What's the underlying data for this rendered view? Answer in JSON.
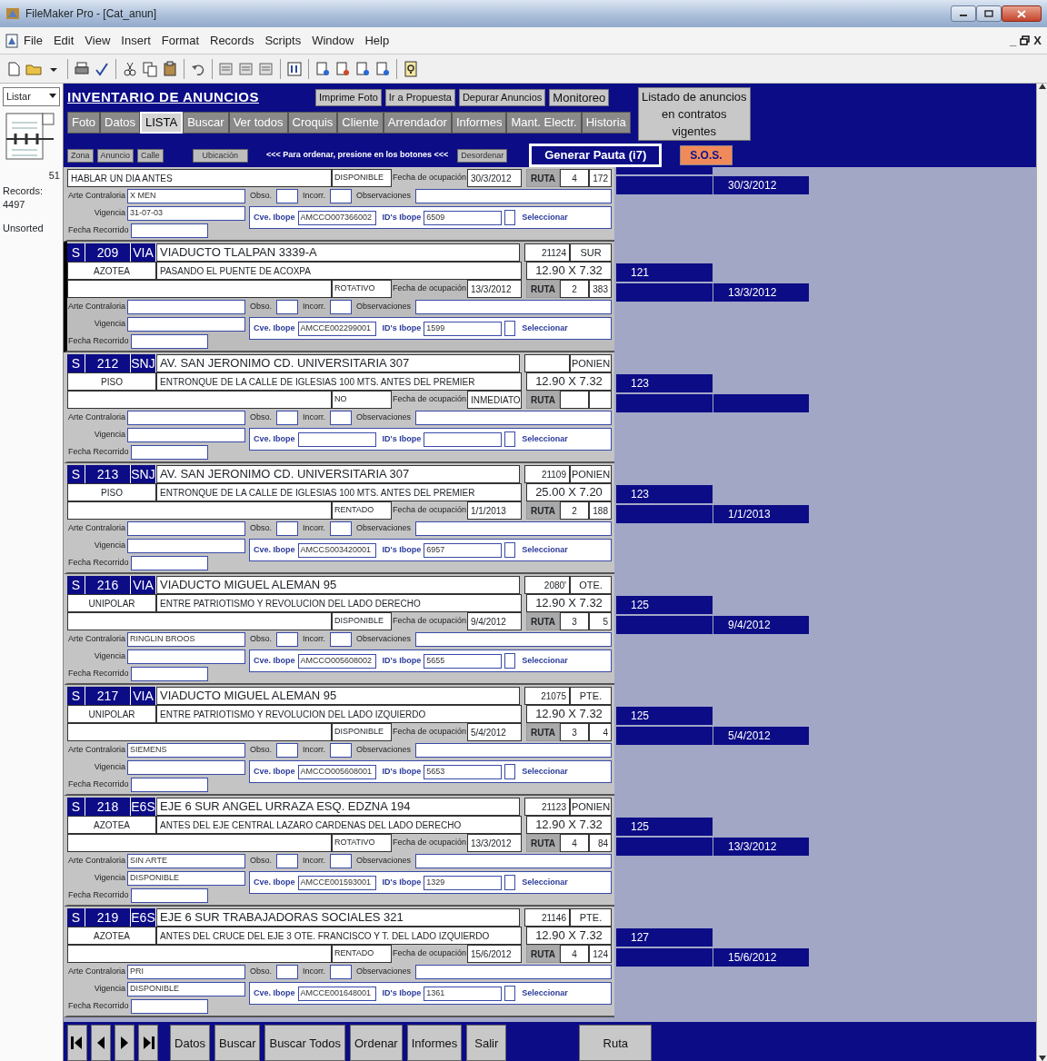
{
  "window": {
    "title": "FileMaker Pro - [Cat_anun]"
  },
  "menu": [
    "File",
    "Edit",
    "View",
    "Insert",
    "Format",
    "Records",
    "Scripts",
    "Window",
    "Help"
  ],
  "doc_controls": [
    "_",
    "X"
  ],
  "status_panel": {
    "layout": "Listar",
    "record_number": "51",
    "records_label": "Records:",
    "records_count": "4497",
    "sort_state": "Unsorted"
  },
  "header": {
    "title": "INVENTARIO DE ANUNCIOS",
    "buttons": [
      "Imprime Foto",
      "Ir a Propuesta",
      "Depurar Anuncios",
      "Monitoreo"
    ],
    "listado_button": "Listado de anuncios en contratos vigentes",
    "tabs": [
      {
        "label": "Foto",
        "selected": false
      },
      {
        "label": "Datos",
        "selected": false
      },
      {
        "label": "LISTA",
        "selected": true
      },
      {
        "label": "Buscar",
        "selected": false
      },
      {
        "label": "Ver todos",
        "selected": false
      },
      {
        "label": "Croquis",
        "selected": false
      },
      {
        "label": "Cliente",
        "selected": false
      },
      {
        "label": "Arrendador",
        "selected": false
      },
      {
        "label": "Informes",
        "selected": false
      },
      {
        "label": "Mant. Electr.",
        "selected": false
      },
      {
        "label": "Historia",
        "selected": false
      }
    ],
    "sort_buttons": [
      "Zona",
      "Anuncio",
      "Calle"
    ],
    "location_button": "Ubicación",
    "sort_hint": "<<< Para ordenar, presione en los botones <<<",
    "unsort_button": "Desordenar",
    "generar_button": "Generar Pauta (i7)",
    "sos_button": "S.O.S."
  },
  "records": [
    {
      "selected": false,
      "note": "HABLAR UN DIA ANTES",
      "status": "DISPONIBLE",
      "fecha_label": "Fecha de ocupación",
      "fecha": "30/3/2012",
      "ruta_label": "RUTA",
      "ruta": "4",
      "ruta_seq": "172",
      "arte_label": "Arte Contraloria",
      "arte": "X MEN",
      "obso_label": "Obso.",
      "incorr_label": "Incorr.",
      "obs_label": "Observaciones",
      "vigencia_label": "Vigencia",
      "vigencia": "31-07-03",
      "recorrido_label": "Fecha Recorrido",
      "cve_label": "Cve. Ibope",
      "cve": "AMCCO007366002",
      "ids_label": "ID's Ibope",
      "ids": "6509",
      "checked": false,
      "select_label": "Seleccionar",
      "side_date": "30/3/2012"
    },
    {
      "selected": true,
      "side": "S",
      "number": "209",
      "code": "VIA",
      "address": "VIADUCTO TLALPAN  3339-A",
      "ref_number": "21124",
      "direction": "SUR",
      "type": "AZOTEA",
      "reference": "PASANDO EL PUENTE DE ACOXPA",
      "size": "12.90  X  7.32",
      "status": "ROTATIVO",
      "fecha_label": "Fecha de ocupación",
      "fecha": "13/3/2012",
      "ruta_label": "RUTA",
      "ruta": "2",
      "ruta_seq": "383",
      "arte_label": "Arte Contraloria",
      "obso_label": "Obso.",
      "incorr_label": "Incorr.",
      "obs_label": "Observaciones",
      "vigencia_label": "Vigencia",
      "recorrido_label": "Fecha Recorrido",
      "cve_label": "Cve. Ibope",
      "cve": "AMCCE002299001",
      "ids_label": "ID's Ibope",
      "ids": "1599",
      "checked": false,
      "select_label": "Seleccionar",
      "side_number": "121",
      "side_date": "13/3/2012"
    },
    {
      "selected": false,
      "side": "S",
      "number": "212",
      "code": "SNJ",
      "address": "AV. SAN JERONIMO  CD. UNIVERSITARIA 307",
      "direction": "PONIEN",
      "type": "PISO",
      "reference": "ENTRONQUE DE LA CALLE DE IGLESIAS 100 MTS. ANTES DEL PREMIER",
      "size": "12.90  X  7.32",
      "status": "NO",
      "fecha_label": "Fecha de ocupación",
      "fecha": "INMEDIATO",
      "ruta_label": "RUTA",
      "arte_label": "Arte Contraloria",
      "obso_label": "Obso.",
      "incorr_label": "Incorr.",
      "obs_label": "Observaciones",
      "vigencia_label": "Vigencia",
      "recorrido_label": "Fecha Recorrido",
      "cve_label": "Cve. Ibope",
      "ids_label": "ID's Ibope",
      "checked": false,
      "select_label": "Seleccionar",
      "side_number": "123"
    },
    {
      "selected": false,
      "side": "S",
      "number": "213",
      "code": "SNJ",
      "address": "AV. SAN JERONIMO  CD. UNIVERSITARIA 307",
      "ref_number": "21109",
      "direction": "PONIEN",
      "type": "PISO",
      "reference": "ENTRONQUE DE LA CALLE DE IGLESIAS 100 MTS. ANTES DEL PREMIER",
      "size": "25.00  X  7.20",
      "status": "RENTADO",
      "fecha_label": "Fecha de ocupación",
      "fecha": "1/1/2013",
      "ruta_label": "RUTA",
      "ruta": "2",
      "ruta_seq": "188",
      "arte_label": "Arte Contraloria",
      "obso_label": "Obso.",
      "incorr_label": "Incorr.",
      "obs_label": "Observaciones",
      "vigencia_label": "Vigencia",
      "recorrido_label": "Fecha Recorrido",
      "cve_label": "Cve. Ibope",
      "cve": "AMCCS003420001",
      "ids_label": "ID's Ibope",
      "ids": "6957",
      "checked": false,
      "select_label": "Seleccionar",
      "side_number": "123",
      "side_date": "1/1/2013"
    },
    {
      "selected": false,
      "side": "S",
      "number": "216",
      "code": "VIA",
      "address": "VIADUCTO MIGUEL ALEMAN 95",
      "ref_number": "2080'",
      "direction": "OTE.",
      "type": "UNIPOLAR",
      "reference": "ENTRE PATRIOTISMO Y REVOLUCION DEL LADO DERECHO",
      "size": "12.90  X  7.32",
      "status": "DISPONIBLE",
      "fecha_label": "Fecha de ocupación",
      "fecha": "9/4/2012",
      "ruta_label": "RUTA",
      "ruta": "3",
      "ruta_seq": "5",
      "arte_label": "Arte Contraloria",
      "arte": "RINGLIN BROOS",
      "obso_label": "Obso.",
      "incorr_label": "Incorr.",
      "obs_label": "Observaciones",
      "vigencia_label": "Vigencia",
      "recorrido_label": "Fecha Recorrido",
      "cve_label": "Cve. Ibope",
      "cve": "AMCCO005608002",
      "ids_label": "ID's Ibope",
      "ids": "5655",
      "checked": false,
      "select_label": "Seleccionar",
      "side_number": "125",
      "side_date": "9/4/2012"
    },
    {
      "selected": false,
      "side": "S",
      "number": "217",
      "code": "VIA",
      "address": "VIADUCTO MIGUEL ALEMAN 95",
      "ref_number": "21075",
      "direction": "PTE.",
      "type": "UNIPOLAR",
      "reference": "ENTRE PATRIOTISMO Y REVOLUCION DEL LADO IZQUIERDO",
      "size": "12.90  X  7.32",
      "status": "DISPONIBLE",
      "fecha_label": "Fecha de ocupación",
      "fecha": "5/4/2012",
      "ruta_label": "RUTA",
      "ruta": "3",
      "ruta_seq": "4",
      "arte_label": "Arte Contraloria",
      "arte": "SIEMENS",
      "obso_label": "Obso.",
      "incorr_label": "Incorr.",
      "obs_label": "Observaciones",
      "vigencia_label": "Vigencia",
      "recorrido_label": "Fecha Recorrido",
      "cve_label": "Cve. Ibope",
      "cve": "AMCCO005608001",
      "ids_label": "ID's Ibope",
      "ids": "5653",
      "checked": false,
      "select_label": "Seleccionar",
      "side_number": "125",
      "side_date": "5/4/2012"
    },
    {
      "selected": false,
      "side": "S",
      "number": "218",
      "code": "E6S",
      "address": "EJE 6  SUR ANGEL URRAZA ESQ. EDZNA 194",
      "ref_number": "21123",
      "direction": "PONIEN",
      "type": "AZOTEA",
      "reference": "ANTES DEL EJE CENTRAL LAZARO CARDENAS DEL LADO DERECHO",
      "size": "12.90  X  7.32",
      "status": "ROTATIVO",
      "fecha_label": "Fecha de ocupación",
      "fecha": "13/3/2012",
      "ruta_label": "RUTA",
      "ruta": "4",
      "ruta_seq": "84",
      "arte_label": "Arte Contraloria",
      "arte": "SIN ARTE",
      "obso_label": "Obso.",
      "incorr_label": "Incorr.",
      "obs_label": "Observaciones",
      "vigencia_label": "Vigencia",
      "vigencia": "DISPONIBLE",
      "recorrido_label": "Fecha Recorrido",
      "cve_label": "Cve. Ibope",
      "cve": "AMCCE001593001",
      "ids_label": "ID's Ibope",
      "ids": "1329",
      "checked": false,
      "select_label": "Seleccionar",
      "side_number": "125",
      "side_date": "13/3/2012"
    },
    {
      "selected": false,
      "side": "S",
      "number": "219",
      "code": "E6S",
      "address": "EJE  6  SUR  TRABAJADORAS  SOCIALES  321",
      "ref_number": "21146",
      "direction": "PTE.",
      "type": "AZOTEA",
      "reference": "ANTES DEL CRUCE DEL EJE 3 OTE. FRANCISCO Y T. DEL LADO IZQUIERDO",
      "size": "12.90  X  7.32",
      "status": "RENTADO",
      "fecha_label": "Fecha de ocupación",
      "fecha": "15/6/2012",
      "ruta_label": "RUTA",
      "ruta": "4",
      "ruta_seq": "124",
      "arte_label": "Arte Contraloria",
      "arte": "PRI",
      "obso_label": "Obso.",
      "incorr_label": "Incorr.",
      "obs_label": "Observaciones",
      "vigencia_label": "Vigencia",
      "vigencia": "DISPONIBLE",
      "recorrido_label": "Fecha Recorrido",
      "cve_label": "Cve. Ibope",
      "cve": "AMCCE001648001",
      "ids_label": "ID's Ibope",
      "ids": "1361",
      "checked": false,
      "select_label": "Seleccionar",
      "side_number": "127",
      "side_date": "15/6/2012"
    }
  ],
  "footer": {
    "buttons": [
      "Datos",
      "Buscar",
      "Buscar Todos",
      "Ordenar",
      "Informes",
      "Salir"
    ],
    "ruta_button": "Ruta"
  }
}
